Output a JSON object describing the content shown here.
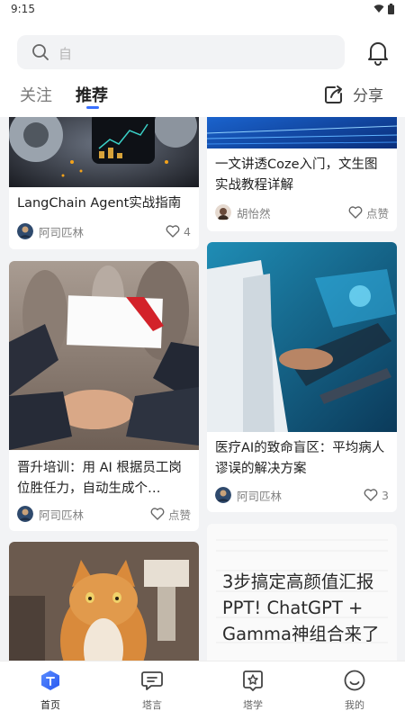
{
  "status_bar": {
    "time": "9:15"
  },
  "search": {
    "placeholder": "自"
  },
  "tabs": {
    "follow": "关注",
    "recommend": "推荐"
  },
  "share_label": "分享",
  "cards": [
    {
      "title": "LangChain Agent实战指南",
      "author": "阿司匹林",
      "likes": "4"
    },
    {
      "title": "一文讲透Coze入门，文生图实战教程详解",
      "author": "胡怡然",
      "likes": "点赞"
    },
    {
      "title": "晋升培训：用 AI 根据员工岗位胜任力，自动生成个…",
      "author": "阿司匹林",
      "likes": "点赞"
    },
    {
      "title": "医疗AI的致命盲区：平均病人谬误的解决方案",
      "author": "阿司匹林",
      "likes": "3"
    },
    {
      "title": "",
      "author": "",
      "likes": ""
    },
    {
      "cover_text": "3步搞定高颜值汇报PPT! ChatGPT + Gamma神组合来了"
    }
  ],
  "nav": {
    "home": "首页",
    "tayan": "塔言",
    "taxue": "塔学",
    "mine": "我的"
  },
  "colors": {
    "accent": "#3970ff",
    "background": "#f2f3f5"
  }
}
